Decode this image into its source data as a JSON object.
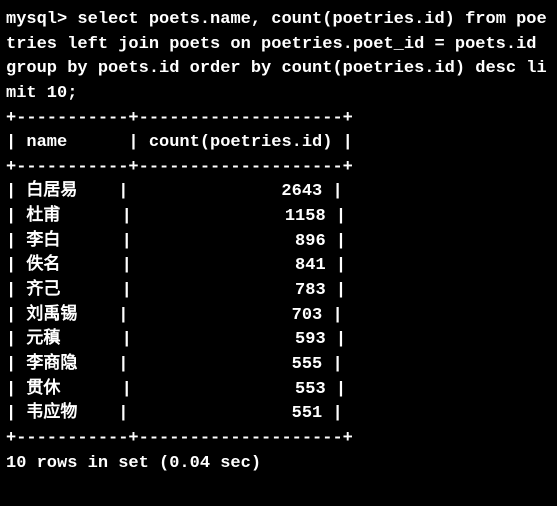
{
  "prompt": "mysql> ",
  "query": "select poets.name, count(poetries.id) from poetries left join poets on poetries.poet_id = poets.id group by poets.id order by count(poetries.id) desc limit 10;",
  "table": {
    "border_top": "+-----------+--------------------+",
    "header_row": "| name      | count(poetries.id) |",
    "border_mid": "+-----------+--------------------+",
    "columns": [
      "name",
      "count(poetries.id)"
    ],
    "rows": [
      {
        "name": "白居易",
        "count": 2643,
        "line": "| 白居易    |               2643 |"
      },
      {
        "name": "杜甫",
        "count": 1158,
        "line": "| 杜甫      |               1158 |"
      },
      {
        "name": "李白",
        "count": 896,
        "line": "| 李白      |                896 |"
      },
      {
        "name": "佚名",
        "count": 841,
        "line": "| 佚名      |                841 |"
      },
      {
        "name": "齐己",
        "count": 783,
        "line": "| 齐己      |                783 |"
      },
      {
        "name": "刘禹锡",
        "count": 703,
        "line": "| 刘禹锡    |                703 |"
      },
      {
        "name": "元稹",
        "count": 593,
        "line": "| 元稹      |                593 |"
      },
      {
        "name": "李商隐",
        "count": 555,
        "line": "| 李商隐    |                555 |"
      },
      {
        "name": "贯休",
        "count": 553,
        "line": "| 贯休      |                553 |"
      },
      {
        "name": "韦应物",
        "count": 551,
        "line": "| 韦应物    |                551 |"
      }
    ],
    "border_bottom": "+-----------+--------------------+"
  },
  "footer": "10 rows in set (0.04 sec)",
  "chart_data": {
    "type": "table",
    "title": "",
    "columns": [
      "name",
      "count(poetries.id)"
    ],
    "data": [
      [
        "白居易",
        2643
      ],
      [
        "杜甫",
        1158
      ],
      [
        "李白",
        896
      ],
      [
        "佚名",
        841
      ],
      [
        "齐己",
        783
      ],
      [
        "刘禹锡",
        703
      ],
      [
        "元稹",
        593
      ],
      [
        "李商隐",
        555
      ],
      [
        "贯休",
        553
      ],
      [
        "韦应物",
        551
      ]
    ]
  }
}
